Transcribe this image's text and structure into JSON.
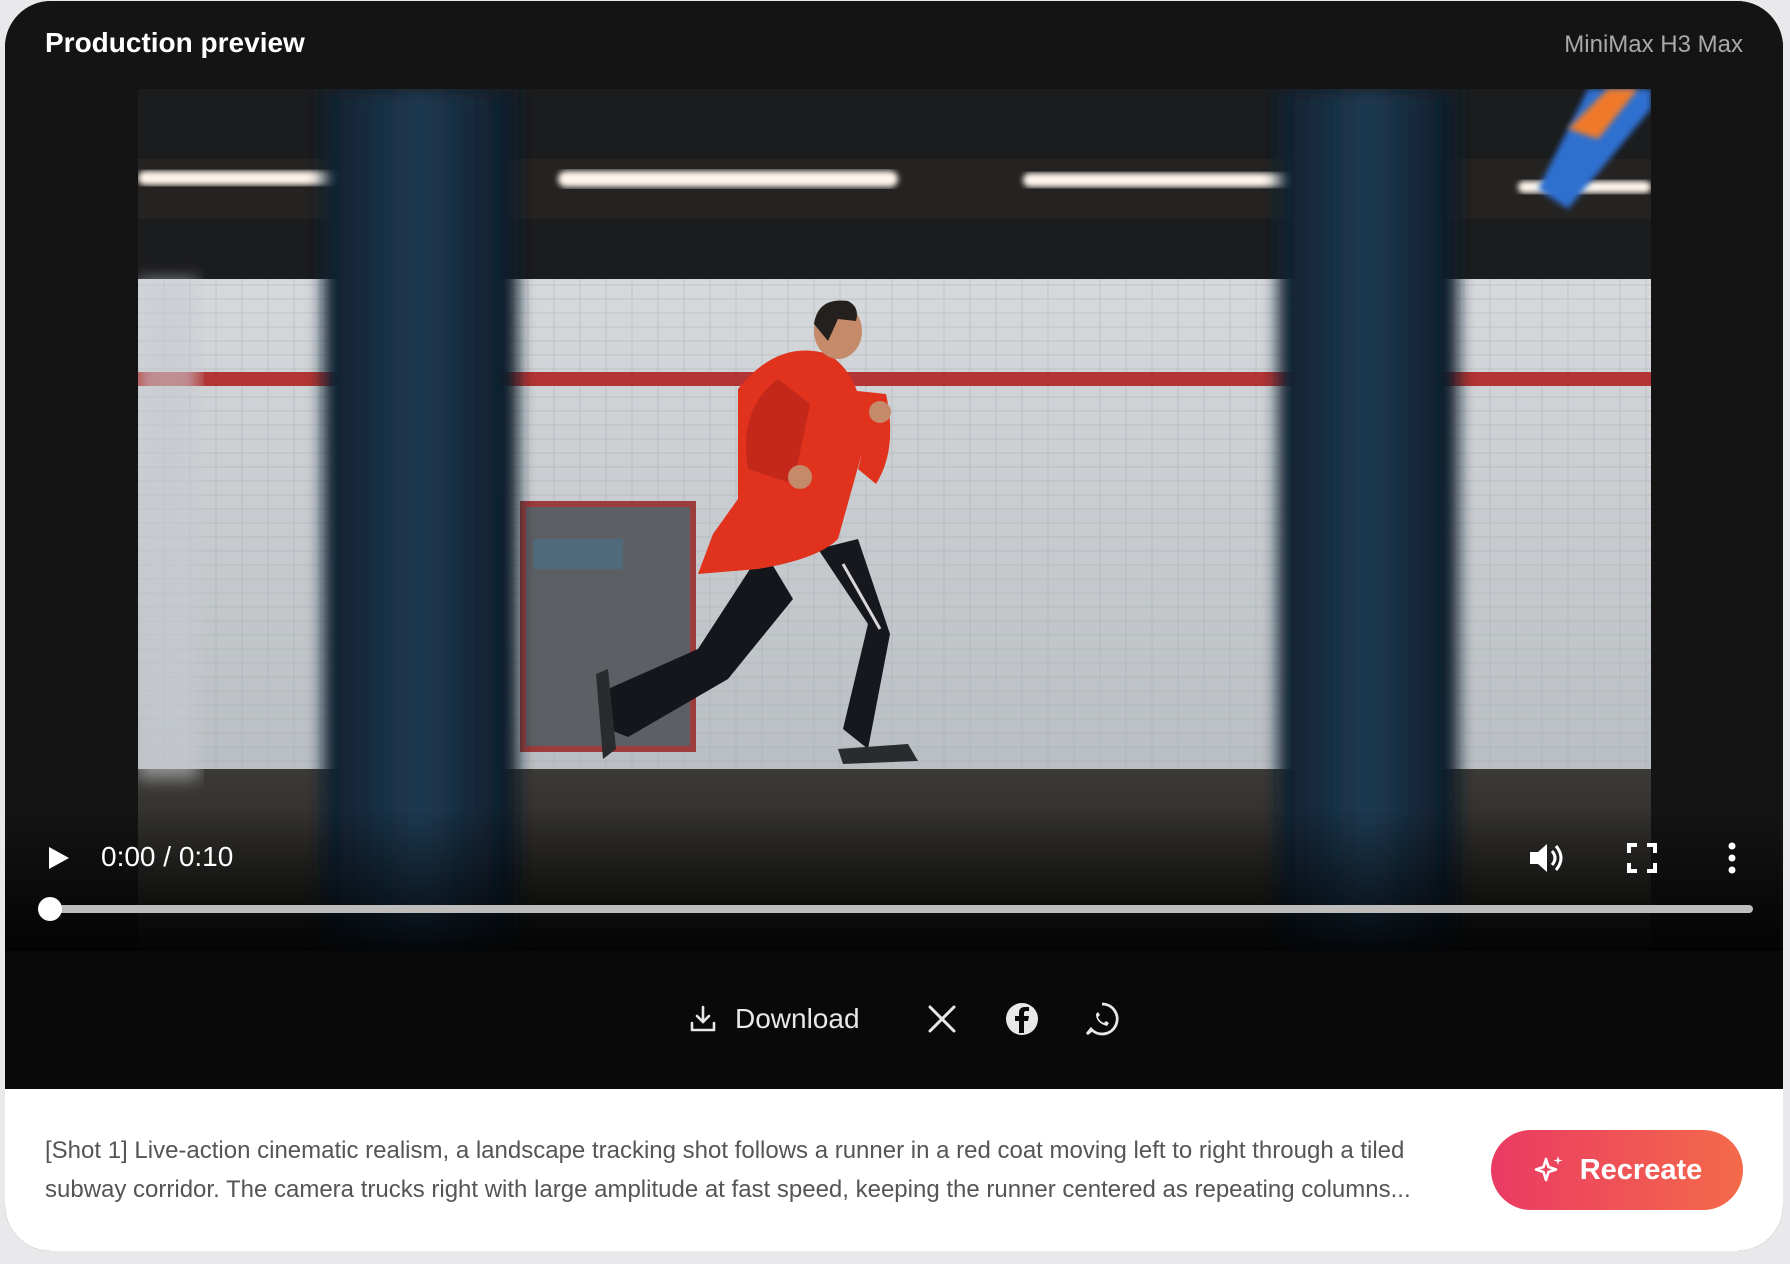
{
  "header": {
    "title": "Production preview",
    "model": "MiniMax H3 Max"
  },
  "player": {
    "time": "0:00 / 0:10",
    "progress_fraction": 0,
    "video_subject": "runner in red coat in tiled subway corridor",
    "icons": {
      "play": "play-icon",
      "volume": "volume-icon",
      "fullscreen": "fullscreen-icon",
      "more": "more-vertical-icon"
    }
  },
  "actions": {
    "download_label": "Download",
    "share": [
      "x-icon",
      "facebook-icon",
      "whatsapp-icon"
    ]
  },
  "prompt": {
    "line1": "[Shot 1] Live-action cinematic realism, a landscape tracking shot follows a runner in a red coat moving left to right through a tiled",
    "line2": "subway corridor. The camera trucks right with large amplitude at fast speed, keeping the runner centered as repeating columns..."
  },
  "recreate": {
    "label": "Recreate",
    "icon": "sparkle-icon"
  },
  "colors": {
    "accent_start": "#ea3a63",
    "accent_end": "#f46a4a",
    "coat": "#e0321c"
  }
}
